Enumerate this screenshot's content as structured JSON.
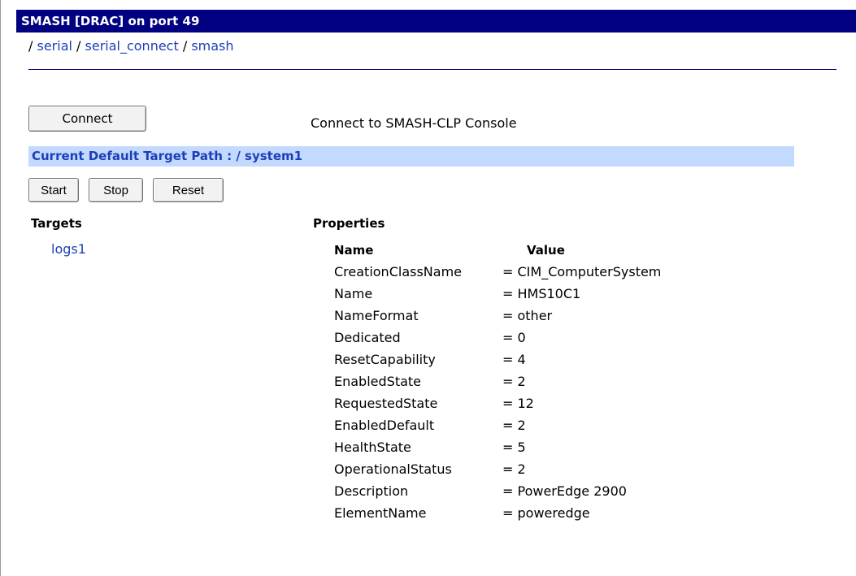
{
  "titlebar": {
    "title": "SMASH [DRAC] on port 49"
  },
  "breadcrumb": {
    "separator": "/",
    "items": [
      "serial",
      "serial_connect",
      "smash"
    ]
  },
  "connect": {
    "button_label": "Connect",
    "description": "Connect to SMASH-CLP Console"
  },
  "target_path": {
    "text": "Current Default Target Path : / system1"
  },
  "actions": {
    "start_label": "Start",
    "stop_label": "Stop",
    "reset_label": "Reset"
  },
  "targets": {
    "heading": "Targets",
    "items": [
      "logs1"
    ]
  },
  "properties": {
    "heading": "Properties",
    "name_header": "Name",
    "value_header": "Value",
    "rows": [
      {
        "name": "CreationClassName",
        "value": "= CIM_ComputerSystem"
      },
      {
        "name": "Name",
        "value": "= HMS10C1"
      },
      {
        "name": "NameFormat",
        "value": "= other"
      },
      {
        "name": "Dedicated",
        "value": "= 0"
      },
      {
        "name": "ResetCapability",
        "value": "= 4"
      },
      {
        "name": "EnabledState",
        "value": "= 2"
      },
      {
        "name": "RequestedState",
        "value": "= 12"
      },
      {
        "name": "EnabledDefault",
        "value": "= 2"
      },
      {
        "name": "HealthState",
        "value": "= 5"
      },
      {
        "name": "OperationalStatus",
        "value": "= 2"
      },
      {
        "name": "Description",
        "value": "= PowerEdge 2900"
      },
      {
        "name": "ElementName",
        "value": "= poweredge"
      }
    ]
  },
  "colors": {
    "titlebar_bg": "#000080",
    "link": "#1c3fb8",
    "target_path_bg": "#c3d9ff"
  }
}
